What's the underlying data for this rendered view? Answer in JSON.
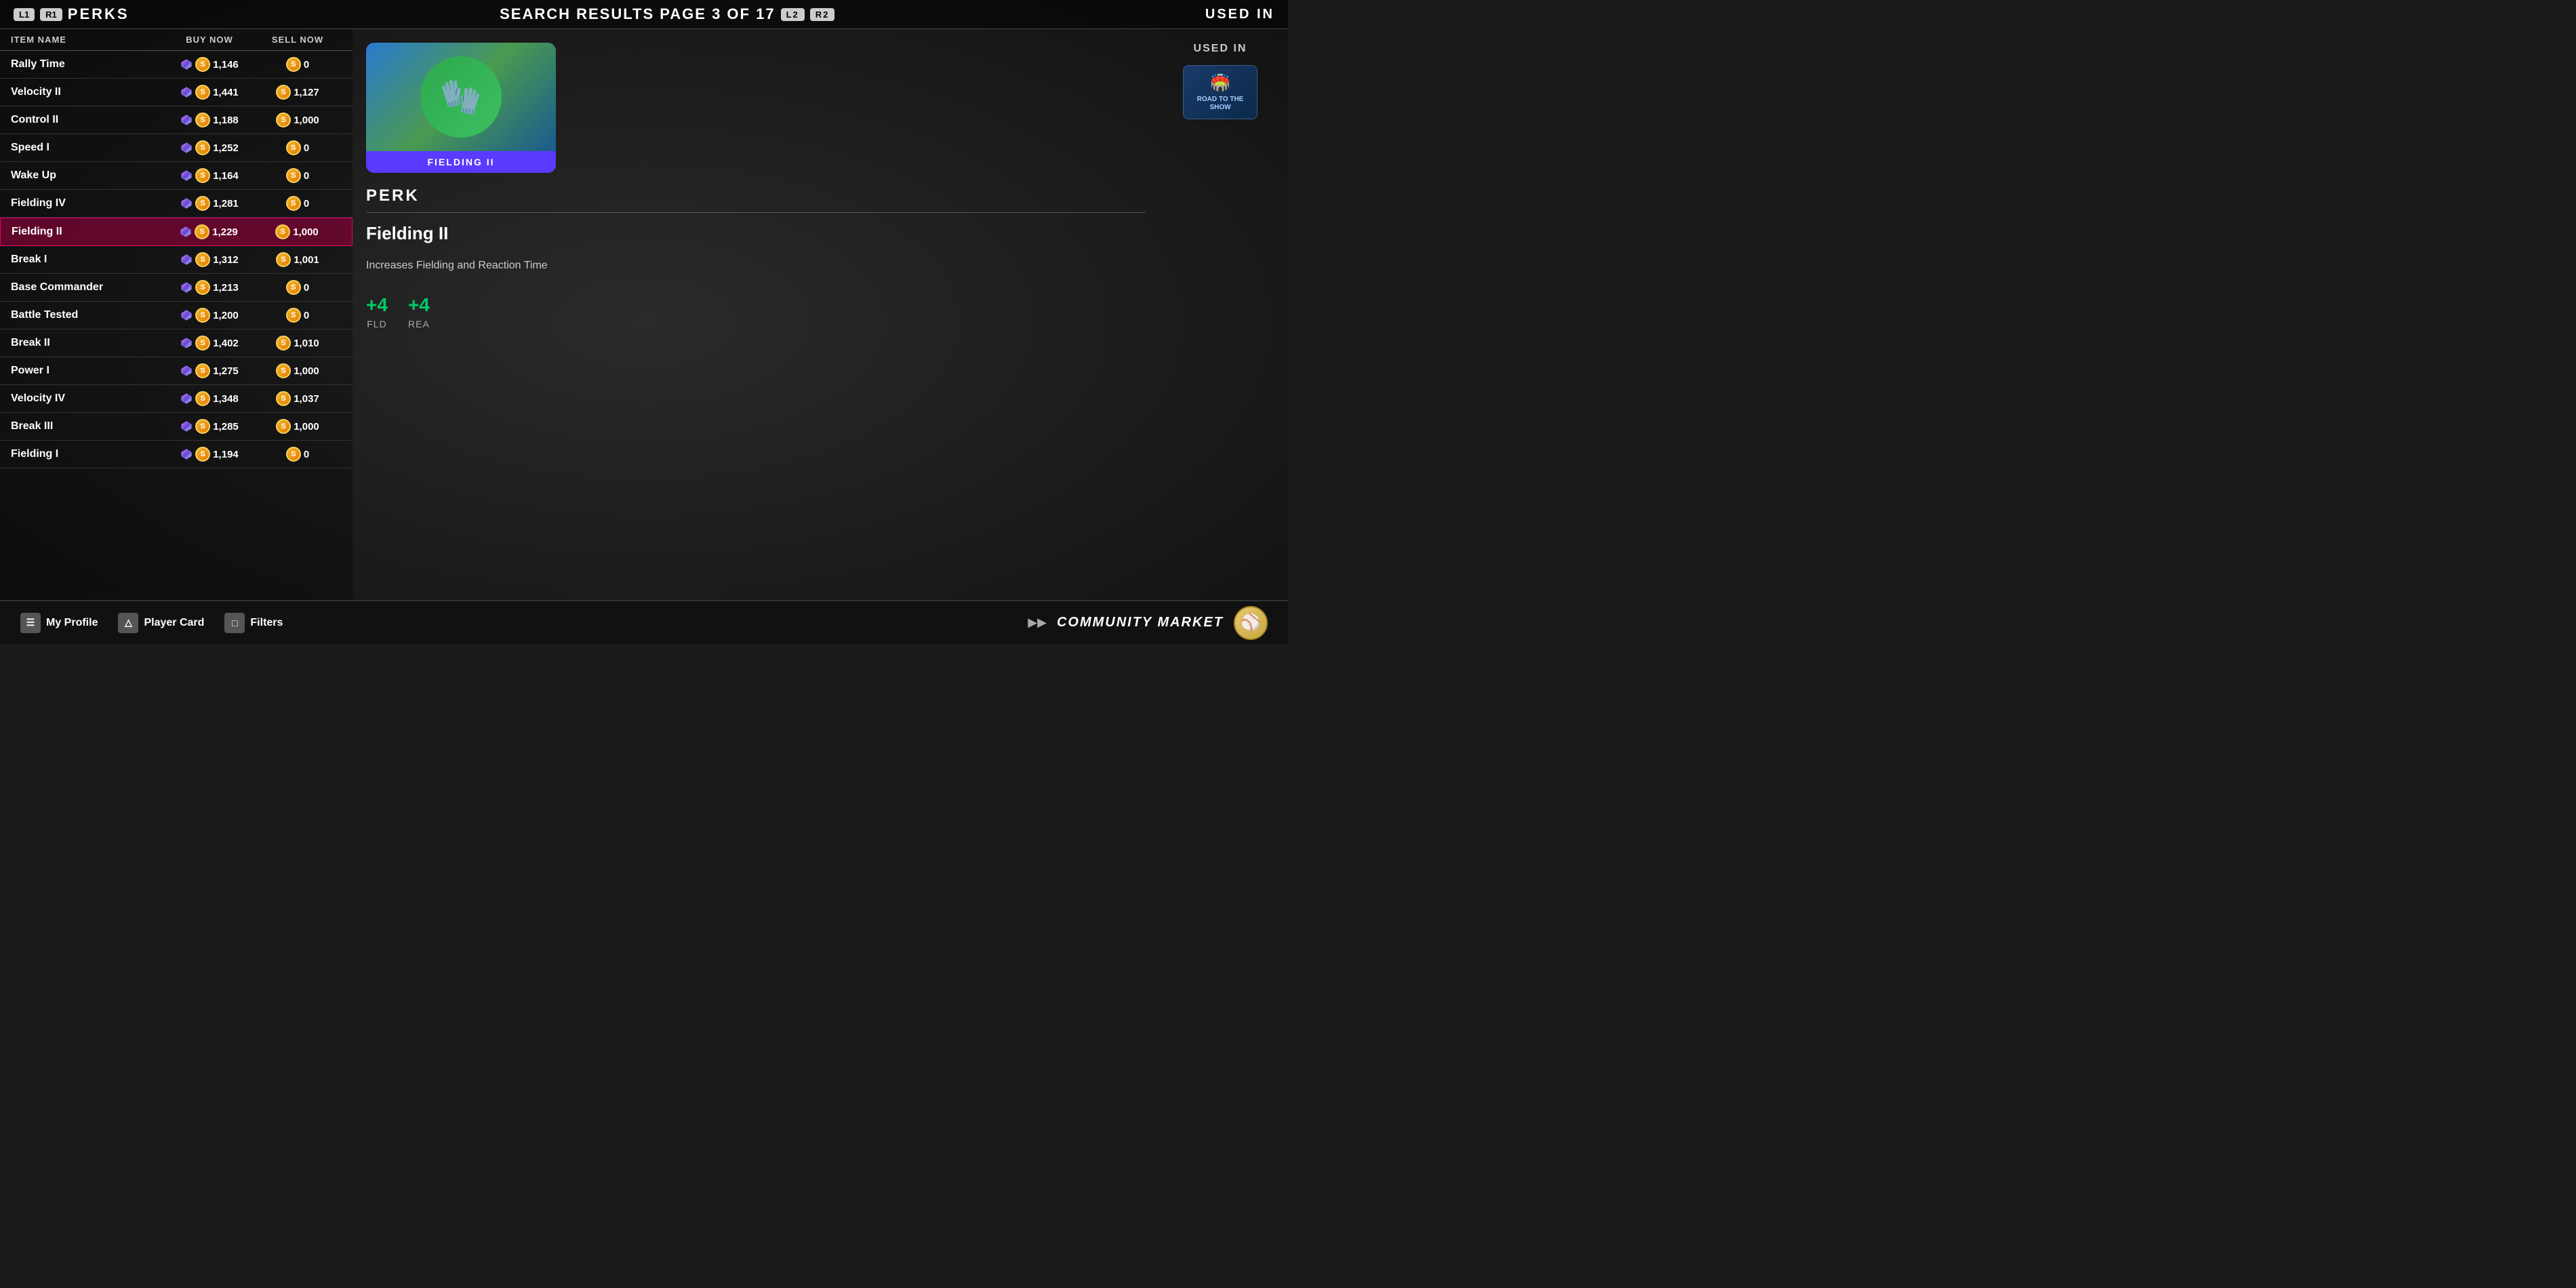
{
  "header": {
    "left_button1": "L1",
    "left_button2": "R1",
    "left_label": "PERKS",
    "center_title": "SEARCH RESULTS PAGE 3 OF 17",
    "right_button1": "L2",
    "right_button2": "R2",
    "right_label": "USED IN"
  },
  "table": {
    "columns": [
      "ITEM NAME",
      "BUY NOW",
      "SELL NOW"
    ],
    "rows": [
      {
        "id": 1,
        "name": "Rally Time",
        "buy": "1,146",
        "sell": "0",
        "selected": false
      },
      {
        "id": 2,
        "name": "Velocity II",
        "buy": "1,441",
        "sell": "1,127",
        "selected": false
      },
      {
        "id": 3,
        "name": "Control II",
        "buy": "1,188",
        "sell": "1,000",
        "selected": false
      },
      {
        "id": 4,
        "name": "Speed I",
        "buy": "1,252",
        "sell": "0",
        "selected": false
      },
      {
        "id": 5,
        "name": "Wake Up",
        "buy": "1,164",
        "sell": "0",
        "selected": false
      },
      {
        "id": 6,
        "name": "Fielding IV",
        "buy": "1,281",
        "sell": "0",
        "selected": false
      },
      {
        "id": 7,
        "name": "Fielding II",
        "buy": "1,229",
        "sell": "1,000",
        "selected": true
      },
      {
        "id": 8,
        "name": "Break I",
        "buy": "1,312",
        "sell": "1,001",
        "selected": false
      },
      {
        "id": 9,
        "name": "Base Commander",
        "buy": "1,213",
        "sell": "0",
        "selected": false
      },
      {
        "id": 10,
        "name": "Battle Tested",
        "buy": "1,200",
        "sell": "0",
        "selected": false
      },
      {
        "id": 11,
        "name": "Break II",
        "buy": "1,402",
        "sell": "1,010",
        "selected": false
      },
      {
        "id": 12,
        "name": "Power I",
        "buy": "1,275",
        "sell": "1,000",
        "selected": false
      },
      {
        "id": 13,
        "name": "Velocity IV",
        "buy": "1,348",
        "sell": "1,037",
        "selected": false
      },
      {
        "id": 14,
        "name": "Break III",
        "buy": "1,285",
        "sell": "1,000",
        "selected": false
      },
      {
        "id": 15,
        "name": "Fielding I",
        "buy": "1,194",
        "sell": "0",
        "selected": false
      }
    ]
  },
  "perk_detail": {
    "card_label": "FIELDING II",
    "type_label": "PERK",
    "name": "Fielding II",
    "description": "Increases Fielding and Reaction Time",
    "stat1_value": "+4",
    "stat1_label": "FLD",
    "stat2_value": "+4",
    "stat2_label": "REA"
  },
  "used_in": {
    "title": "USED IN",
    "badge_line1": "ROAD TO THE",
    "badge_line2": "SHOW"
  },
  "footer": {
    "profile_icon": "☰",
    "profile_label": "My Profile",
    "player_card_icon": "△",
    "player_card_label": "Player Card",
    "filters_icon": "□",
    "filters_label": "Filters",
    "arrows": "▶▶",
    "community_market": "COMMUNITY MARKET"
  }
}
